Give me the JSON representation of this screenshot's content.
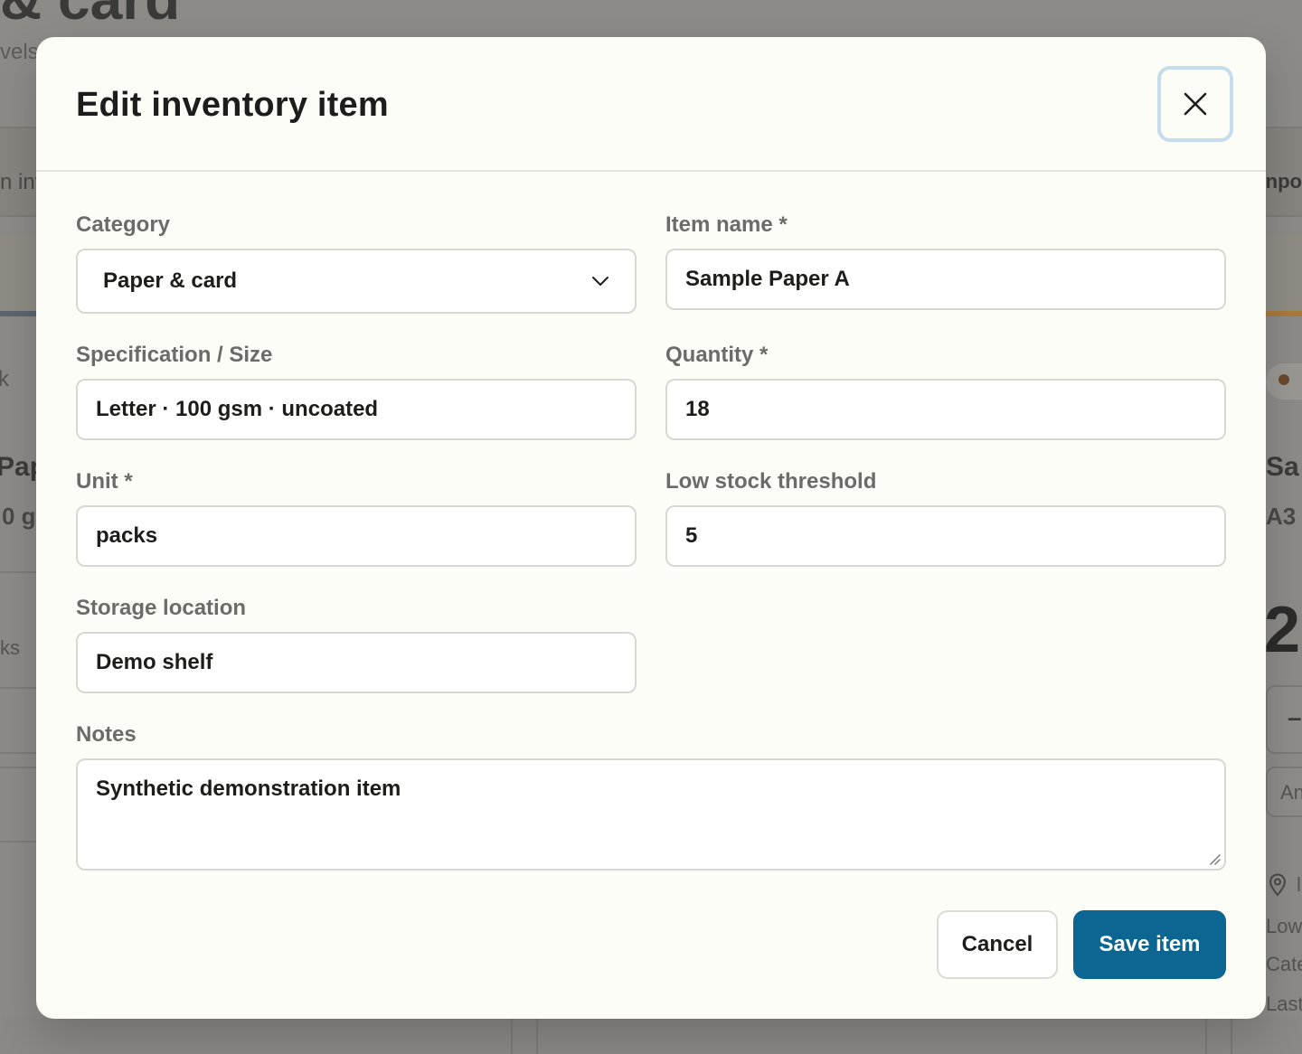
{
  "background": {
    "title": "& card",
    "subtitle": "vels",
    "band_left": "n inv",
    "band_right": "npo",
    "card_left_title": "Pap",
    "card_left_sub": "0 g",
    "card_left_unit": "ks",
    "card_left_marker": "k",
    "card_right_title": "Sa",
    "card_right_sub": "A3",
    "card_right_qty": "2",
    "card_right_minus": "–",
    "card_right_input": "An",
    "card_right_location": "l",
    "card_right_low": "Low",
    "card_right_cat": "Cate",
    "card_right_last": "Last"
  },
  "modal": {
    "title": "Edit inventory item",
    "close_label": "Close",
    "fields": {
      "category": {
        "label": "Category",
        "value": "Paper & card"
      },
      "item_name": {
        "label": "Item name *",
        "value": "Sample Paper A"
      },
      "specification": {
        "label": "Specification / Size",
        "value": "Letter · 100 gsm · uncoated"
      },
      "quantity": {
        "label": "Quantity *",
        "value": "18"
      },
      "unit": {
        "label": "Unit *",
        "value": "packs"
      },
      "low_stock": {
        "label": "Low stock threshold",
        "value": "5"
      },
      "storage": {
        "label": "Storage location",
        "value": "Demo shelf"
      },
      "notes": {
        "label": "Notes",
        "value": "Synthetic demonstration item"
      }
    },
    "buttons": {
      "cancel": "Cancel",
      "save": "Save item"
    }
  },
  "colors": {
    "primary": "#0d6592",
    "focus_ring": "#c4dceb",
    "modal_bg": "#fdfdf8",
    "overlay": "#8a8985"
  },
  "icons": {
    "close": "close-icon",
    "dropdown": "chevron-down-icon",
    "resize": "resize-grip-icon",
    "location": "map-pin-icon"
  }
}
